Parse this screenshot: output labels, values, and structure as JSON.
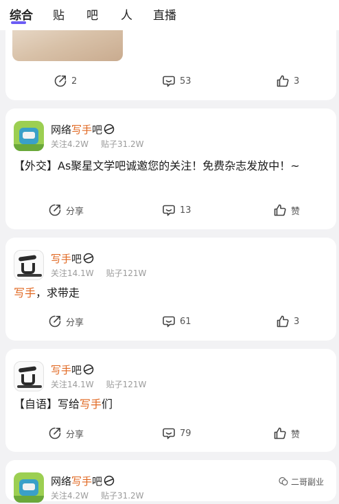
{
  "tabs": {
    "items": [
      {
        "label": "综合",
        "active": true
      },
      {
        "label": "贴"
      },
      {
        "label": "吧"
      },
      {
        "label": "人"
      },
      {
        "label": "直播"
      }
    ],
    "indicator_color": "#6b5cf5"
  },
  "colors": {
    "highlight": "#e0661f",
    "muted": "#9b9b9b"
  },
  "posts": [
    {
      "share": "2",
      "comments": "53",
      "likes": "3"
    },
    {
      "bar_name_pre": "网络",
      "bar_name_hl": "写手",
      "bar_name_post": "吧",
      "follow": "关注4.2W",
      "posts": "贴子31.2W",
      "content": "【外交】As聚星文学吧诚邀您的关注！免费杂志发放中！~",
      "share": "分享",
      "comments": "13",
      "likes": "赞",
      "avatar_icon": "green-bar-logo"
    },
    {
      "bar_name_hl": "写手",
      "bar_name_post": "吧",
      "follow": "关注14.1W",
      "posts": "贴子121W",
      "content_hl": "写手",
      "content_rest": "，求带走",
      "share": "分享",
      "comments": "61",
      "likes": "3",
      "avatar_icon": "ink-calligraphy-logo"
    },
    {
      "bar_name_hl": "写手",
      "bar_name_post": "吧",
      "follow": "关注14.1W",
      "posts": "贴子121W",
      "content_pre": "【自语】写给",
      "content_hl": "写手",
      "content_post": "们",
      "share": "分享",
      "comments": "79",
      "likes": "赞",
      "avatar_icon": "ink-calligraphy-logo"
    },
    {
      "bar_name_pre": "网络",
      "bar_name_hl": "写手",
      "bar_name_post": "吧",
      "follow": "关注4.2W",
      "posts": "贴子31.2W",
      "avatar_icon": "green-bar-logo"
    }
  ],
  "watermark": "二哥副业"
}
